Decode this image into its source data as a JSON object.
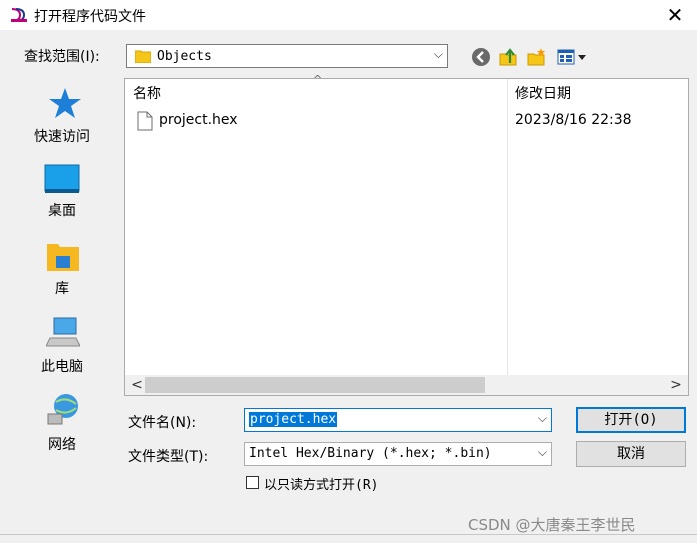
{
  "window": {
    "title": "打开程序代码文件",
    "close_glyph": "✕"
  },
  "toolbar": {
    "look_in_label": "查找范围(I):",
    "look_in_value": "Objects",
    "dropdown_glyph": "⌵"
  },
  "places": [
    {
      "label": "快速访问",
      "icon": "star-icon"
    },
    {
      "label": "桌面",
      "icon": "desktop-icon"
    },
    {
      "label": "库",
      "icon": "library-icon"
    },
    {
      "label": "此电脑",
      "icon": "computer-icon"
    },
    {
      "label": "网络",
      "icon": "network-icon"
    }
  ],
  "file_list": {
    "columns": [
      "名称",
      "修改日期"
    ],
    "sort_glyph": "^",
    "rows": [
      {
        "name": "project.hex",
        "modified": "2023/8/16 22:38"
      }
    ],
    "scroll_left": "<",
    "scroll_right": ">"
  },
  "form": {
    "filename_label": "文件名(N):",
    "filename_value": "project.hex",
    "filetype_label": "文件类型(T):",
    "filetype_value": "Intel Hex/Binary (*.hex; *.bin)",
    "readonly_label": "以只读方式打开(R)",
    "readonly_checked": false,
    "open_button": "打开(O)",
    "cancel_button": "取消"
  },
  "watermark": "CSDN @大唐秦王李世民",
  "colors": {
    "accent": "#0078d7",
    "dialog_bg": "#f0f0f0"
  }
}
